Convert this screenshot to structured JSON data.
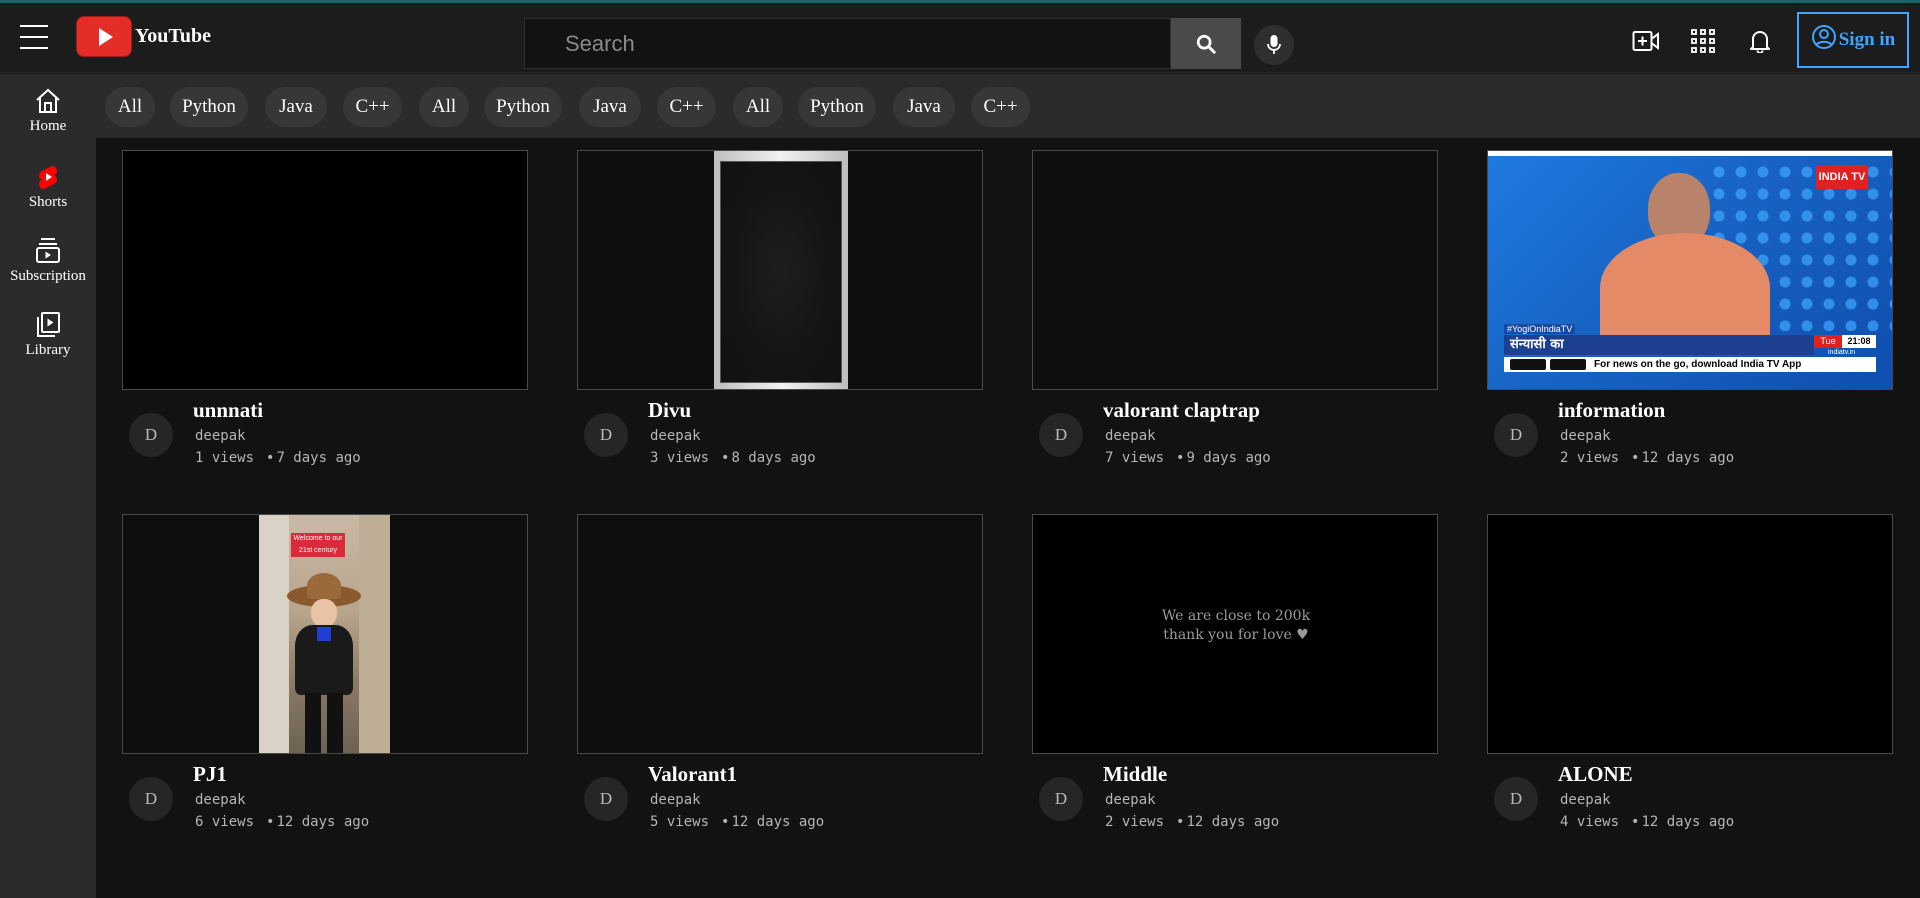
{
  "header": {
    "logo_text": "YouTube",
    "search_placeholder": "Search",
    "signin_label": "Sign in",
    "icons": [
      "menu-icon",
      "youtube-logo-icon",
      "search-icon",
      "mic-icon",
      "create-video-icon",
      "apps-grid-icon",
      "bell-icon",
      "account-icon"
    ],
    "accent_color": "#3ea6ff",
    "brand_color": "#e52d27"
  },
  "sidebar": {
    "items": [
      {
        "label": "Home",
        "icon": "home-icon"
      },
      {
        "label": "Shorts",
        "icon": "shorts-icon"
      },
      {
        "label": "Subscription",
        "icon": "subscriptions-icon"
      },
      {
        "label": "Library",
        "icon": "library-icon"
      }
    ]
  },
  "chips": [
    "All",
    "Python",
    "Java",
    "C++",
    "All",
    "Python",
    "Java",
    "C++",
    "All",
    "Python",
    "Java",
    "C++"
  ],
  "videos": [
    {
      "title": "unnnati",
      "channel": "deepak",
      "avatar": "D",
      "views": "1 views",
      "age": "7 days ago"
    },
    {
      "title": "Divu",
      "channel": "deepak",
      "avatar": "D",
      "views": "3 views",
      "age": "8 days ago"
    },
    {
      "title": "valorant claptrap",
      "channel": "deepak",
      "avatar": "D",
      "views": "7 views",
      "age": "9 days ago"
    },
    {
      "title": "information",
      "channel": "deepak",
      "avatar": "D",
      "views": "2 views",
      "age": "12 days ago",
      "thumb_text": {
        "brand": "INDIA TV",
        "hashtag": "#YogiOnIndiaTV",
        "headline": "संन्यासी का",
        "day": "Tue",
        "time": "21:08",
        "site": "indiatv.in",
        "ticker": "For news on the go, download India TV App"
      }
    },
    {
      "title": "PJ1",
      "channel": "deepak",
      "avatar": "D",
      "views": "6 views",
      "age": "12 days ago",
      "thumb_text": {
        "caption_1": "Welcome to our",
        "caption_2": "21st century"
      }
    },
    {
      "title": "Valorant1",
      "channel": "deepak",
      "avatar": "D",
      "views": "5 views",
      "age": "12 days ago"
    },
    {
      "title": "Middle",
      "channel": "deepak",
      "avatar": "D",
      "views": "2 views",
      "age": "12 days ago",
      "thumb_text": {
        "line_1": "We are close to 200k",
        "line_2": "thank you for love ♥"
      }
    },
    {
      "title": "ALONE",
      "channel": "deepak",
      "avatar": "D",
      "views": "4 views",
      "age": "12 days ago"
    }
  ]
}
